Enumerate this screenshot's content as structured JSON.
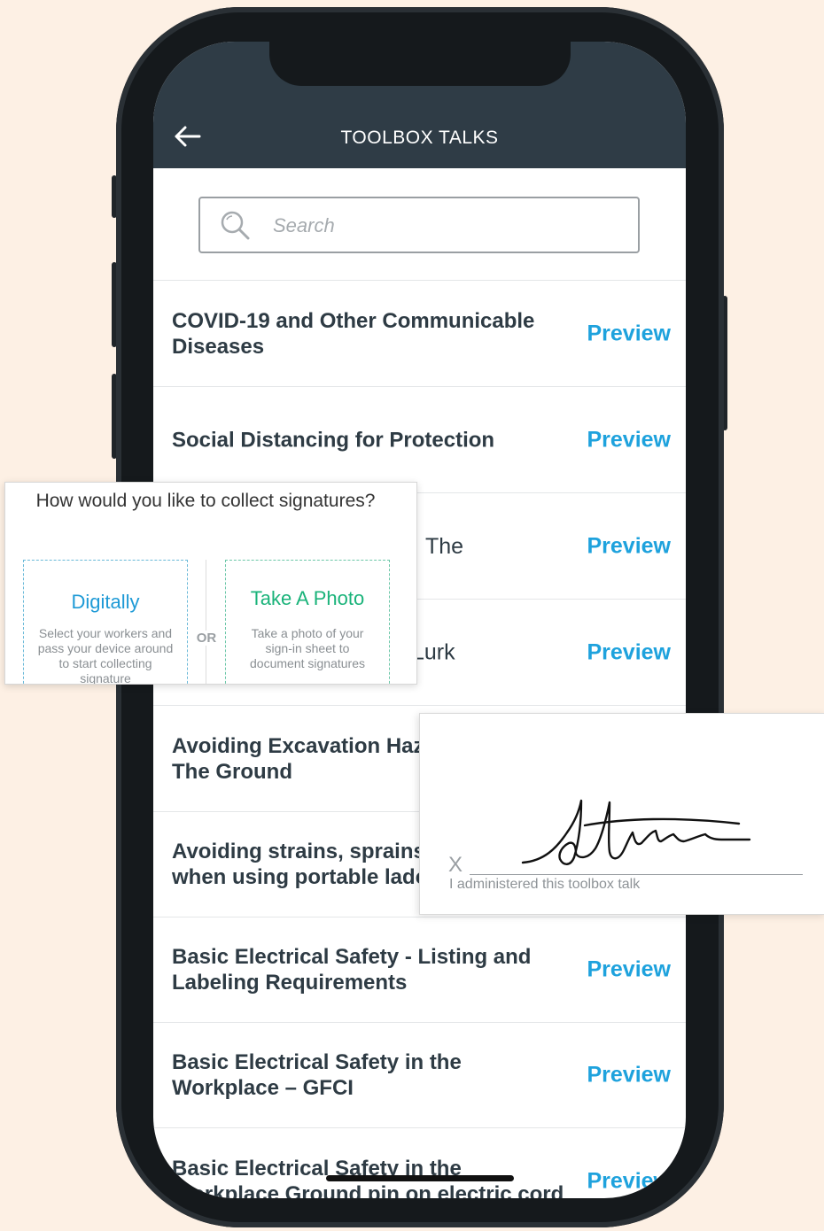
{
  "header": {
    "title": "TOOLBOX TALKS"
  },
  "search": {
    "placeholder": "Search"
  },
  "list": {
    "preview_label": "Preview",
    "items": [
      {
        "title": "COVID-19 and Other Communicable Diseases"
      },
      {
        "title": "Social Distancing for Protection"
      },
      {
        "title": "The"
      },
      {
        "title": "Lurk"
      },
      {
        "title": "Avoiding Excavation Haz The Ground"
      },
      {
        "title": "Avoiding strains, sprains when using portable ladc"
      },
      {
        "title": "Basic Electrical Safety - Listing and Labeling Requirements"
      },
      {
        "title": "Basic Electrical Safety in the Workplace – GFCI"
      },
      {
        "title": "Basic Electrical Safety in the Workplace Ground pin on electric cord"
      }
    ]
  },
  "signature_popup": {
    "question": "How would you like to collect signatures?",
    "or_label": "OR",
    "digital": {
      "title": "Digitally",
      "description": "Select your workers and pass your device around to start collecting signature"
    },
    "photo": {
      "title": "Take A Photo",
      "description": "Take a photo of your sign-in sheet to document signatures"
    }
  },
  "signature_card": {
    "x_mark": "X",
    "label": "I administered this toolbox talk"
  }
}
